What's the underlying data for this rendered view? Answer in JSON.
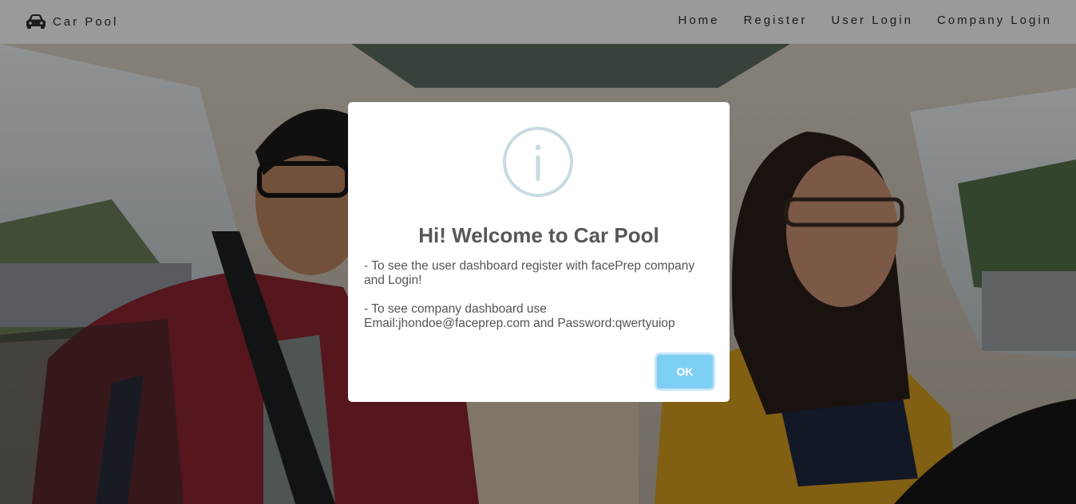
{
  "navbar": {
    "brand": {
      "icon": "car-icon",
      "label": "Car Pool"
    },
    "links": [
      {
        "label": "Home"
      },
      {
        "label": "Register"
      },
      {
        "label": "User Login"
      },
      {
        "label": "Company Login"
      }
    ]
  },
  "modal": {
    "icon": "info-circle-icon",
    "title": "Hi! Welcome to Car Pool",
    "lines": [
      "- To see the user dashboard register with facePrep company and Login!",
      "- To see company dashboard use Email:jhondoe@faceprep.com and Password:qwertyuiop"
    ],
    "ok_label": "OK"
  },
  "colors": {
    "navbar_bg": "#9a9a9a",
    "ok_button": "#7ecff4",
    "info_icon": "#c9dae1",
    "title_text": "#575757"
  }
}
